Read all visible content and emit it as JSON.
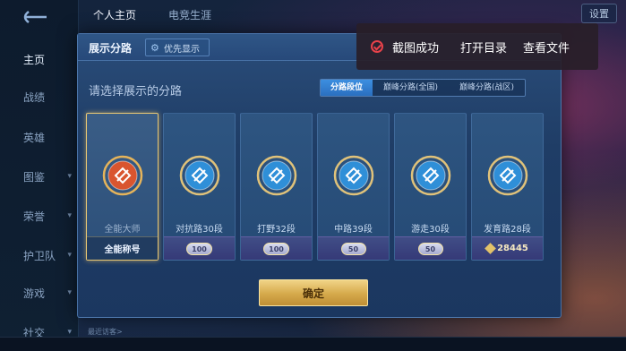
{
  "sidebar": {
    "items": [
      {
        "label": "主页",
        "active": true,
        "chevron": false
      },
      {
        "label": "战绩",
        "active": false,
        "chevron": false
      },
      {
        "label": "英雄",
        "active": false,
        "chevron": false
      },
      {
        "label": "图鉴",
        "active": false,
        "chevron": true
      },
      {
        "label": "荣誉",
        "active": false,
        "chevron": true
      },
      {
        "label": "护卫队",
        "active": false,
        "chevron": true
      },
      {
        "label": "游戏",
        "active": false,
        "chevron": true
      },
      {
        "label": "社交",
        "active": false,
        "chevron": true
      }
    ]
  },
  "top": {
    "tab_home": "个人主页",
    "tab_career": "电竞生涯",
    "settings": "设置"
  },
  "modal": {
    "title": "展示分路",
    "priority_label": "优先显示",
    "prompt": "请选择展示的分路",
    "segments": [
      {
        "label": "分路段位",
        "active": true
      },
      {
        "label": "巅峰分路(全国)",
        "active": false
      },
      {
        "label": "巅峰分路(战区)",
        "active": false
      }
    ],
    "cards": [
      {
        "label": "全能大师",
        "foot": "全能称号",
        "foot_type": "title",
        "selected": true,
        "color": "#d9552f"
      },
      {
        "label": "对抗路30段",
        "foot": "100",
        "foot_type": "rank",
        "selected": false,
        "color": "#2f8fd8"
      },
      {
        "label": "打野32段",
        "foot": "100",
        "foot_type": "rank",
        "selected": false,
        "color": "#2f8fd8"
      },
      {
        "label": "中路39段",
        "foot": "50",
        "foot_type": "rank",
        "selected": false,
        "color": "#2f8fd8"
      },
      {
        "label": "游走30段",
        "foot": "50",
        "foot_type": "rank",
        "selected": false,
        "color": "#2f8fd8"
      },
      {
        "label": "发育路28段",
        "foot": "28445",
        "foot_type": "coin",
        "selected": false,
        "color": "#2f8fd8"
      }
    ],
    "confirm": "确定"
  },
  "toast": {
    "message": "截图成功",
    "open_dir": "打开目录",
    "view_file": "查看文件"
  },
  "bottom": {
    "hint": "最近访客>"
  },
  "colors": {
    "accent_gold": "#e8c774",
    "segment_active": "#3d8fe0",
    "toast_icon": "#e8424a"
  }
}
